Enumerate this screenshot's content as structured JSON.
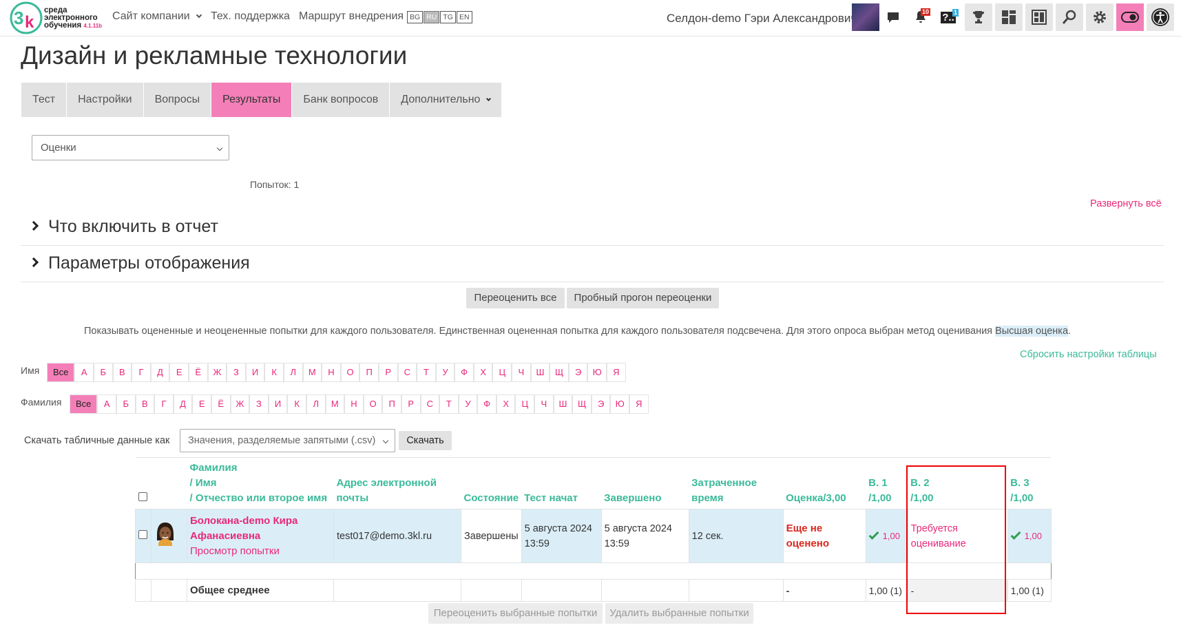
{
  "navbar": {
    "logo_text_line1": "среда",
    "logo_text_line2": "электронного",
    "logo_text_line3": "обучения",
    "logo_version": "4.1.11b",
    "links": [
      "Сайт компании",
      "Тех. поддержка",
      "Маршрут внедрения"
    ],
    "languages": [
      "BG",
      "RU",
      "TG",
      "EN"
    ],
    "active_language": "RU",
    "user_name": "Селдон-demo Гэри Александрович",
    "notifications_count": "10",
    "questions_count": "1"
  },
  "page": {
    "title": "Дизайн и рекламные технологии",
    "tabs": [
      "Тест",
      "Настройки",
      "Вопросы",
      "Результаты",
      "Банк вопросов",
      "Дополнительно"
    ],
    "active_tab": "Результаты",
    "report_select": "Оценки",
    "attempts": "Попыток: 1",
    "expand_all": "Развернуть всё",
    "section1": "Что включить в отчет",
    "section2": "Параметры отображения",
    "regrade_all": "Переоценить все",
    "dry_run": "Пробный прогон переоценки",
    "info_text": "Показывать оцененные и неоцененные попытки для каждого пользователя. Единственная оцененная попытка для каждого пользователя подсвечена. Для этого опроса выбран метод оценивания",
    "info_method": "Высшая оценка",
    "info_end": ".",
    "reset_table": "Сбросить настройки таблицы"
  },
  "filters": {
    "first_name_label": "Имя",
    "last_name_label": "Фамилия",
    "all_label": "Все",
    "letters": [
      "А",
      "Б",
      "В",
      "Г",
      "Д",
      "Е",
      "Ё",
      "Ж",
      "З",
      "И",
      "К",
      "Л",
      "М",
      "Н",
      "О",
      "П",
      "Р",
      "С",
      "Т",
      "У",
      "Ф",
      "Х",
      "Ц",
      "Ч",
      "Ш",
      "Щ",
      "Э",
      "Ю",
      "Я"
    ]
  },
  "download": {
    "label": "Скачать табличные данные как",
    "format": "Значения, разделяемые запятыми (.csv)",
    "button": "Скачать"
  },
  "table": {
    "header": {
      "last_name": "Фамилия",
      "first_name": "/ Имя",
      "patronymic": "/ Отчество или второе имя",
      "email_1": "Адрес электронной",
      "email_2": "почты",
      "state": "Состояние",
      "started": "Тест начат",
      "completed": "Завершено",
      "time_1": "Затраченное",
      "time_2": "время",
      "grade": "Оценка/3,00",
      "q1_a": "В. 1",
      "q1_b": "/1,00",
      "q2_a": "В. 2",
      "q2_b": "/1,00",
      "q3_a": "В. 3",
      "q3_b": "/1,00"
    },
    "row": {
      "name": "Болокана-demo Кира Афанасиевна",
      "review": "Просмотр попытки",
      "email": "test017@demo.3kl.ru",
      "state": "Завершены",
      "started": "5 августа 2024 13:59",
      "completed": "5 августа 2024 13:59",
      "time": "12 сек.",
      "grade": "Еще не оценено",
      "q1": "1,00",
      "q2": "Требуется оценивание",
      "q3": "1,00"
    },
    "total": {
      "label": "Общее среднее",
      "grade": "-",
      "q1": "1,00 (1)",
      "q2": "-",
      "q3": "1,00 (1)"
    }
  },
  "bottom_buttons": {
    "regrade_selected": "Переоценить выбранные попытки",
    "delete_selected": "Удалить выбранные попытки"
  }
}
